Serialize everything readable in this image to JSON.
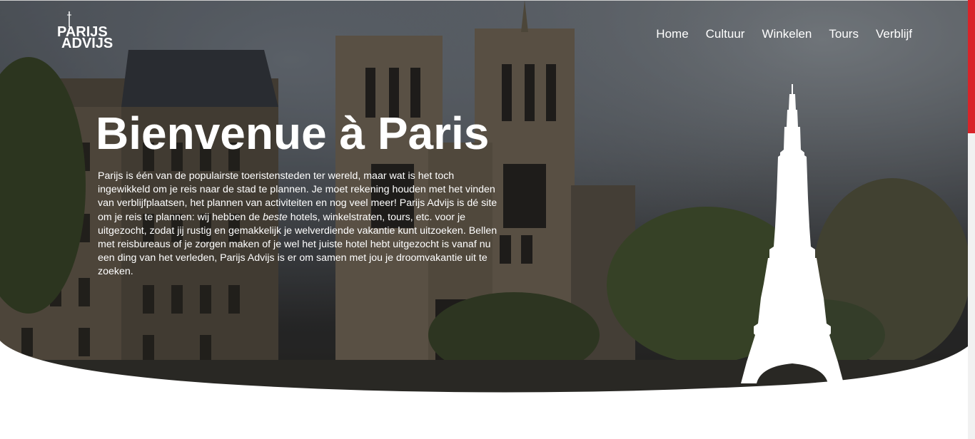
{
  "logo": {
    "line1": "PARIJS",
    "line2": "ADVIJS"
  },
  "nav": {
    "items": [
      {
        "label": "Home"
      },
      {
        "label": "Cultuur"
      },
      {
        "label": "Winkelen"
      },
      {
        "label": "Tours"
      },
      {
        "label": "Verblijf"
      }
    ]
  },
  "hero": {
    "title": "Bienvenue à Paris",
    "intro_before_em": "Parijs is één van de populairste toeristensteden ter wereld, maar wat is het toch ingewikkeld om je reis naar de stad te plannen. Je moet rekening houden met het vinden van verblijfplaatsen, het plannen van activiteiten en nog veel meer! Parijs Advijs is dé site om je reis te plannen: wij hebben de ",
    "intro_em": "beste",
    "intro_after_em": " hotels, winkelstraten, tours, etc. voor je uitgezocht, zodat jij rustig en gemakkelijk je welverdiende vakantie kunt uitzoeken. Bellen met reisbureaus of je zorgen maken of je wel het juiste hotel hebt uitgezocht is vanaf nu een ding van het verleden, Parijs Advijs is er om samen met jou je droomvakantie uit te zoeken."
  },
  "colors": {
    "accent": "#d92328",
    "text_on_hero": "#ffffff",
    "background": "#ffffff"
  },
  "icons": {
    "eiffel": "eiffel-tower-icon",
    "logo_spire": "eiffel-spire-icon"
  }
}
